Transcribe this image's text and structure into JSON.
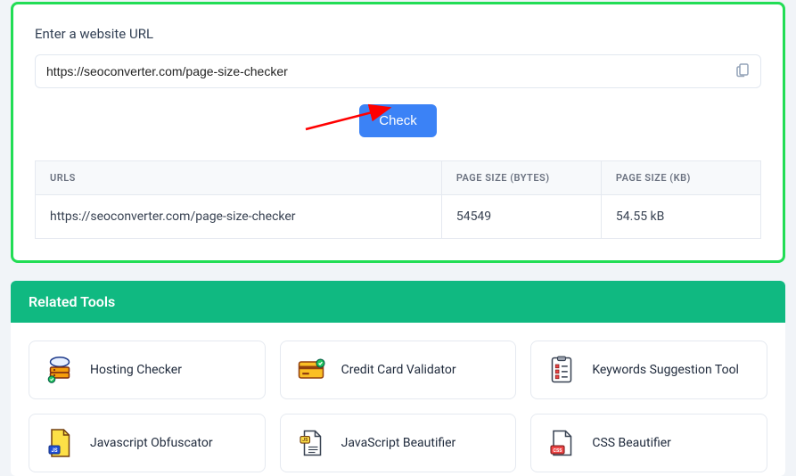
{
  "form": {
    "label": "Enter a website URL",
    "url_value": "https://seoconverter.com/page-size-checker",
    "check_label": "Check"
  },
  "table": {
    "headers": {
      "urls": "URLS",
      "bytes": "PAGE SIZE (BYTES)",
      "kb": "PAGE SIZE (KB)"
    },
    "row": {
      "url": "https://seoconverter.com/page-size-checker",
      "bytes": "54549",
      "kb": "54.55 kB"
    }
  },
  "related": {
    "title": "Related Tools",
    "tools": [
      {
        "name": "Hosting Checker"
      },
      {
        "name": "Credit Card Validator"
      },
      {
        "name": "Keywords Suggestion Tool"
      },
      {
        "name": "Javascript Obfuscator"
      },
      {
        "name": "JavaScript Beautifier"
      },
      {
        "name": "CSS Beautifier"
      }
    ]
  }
}
